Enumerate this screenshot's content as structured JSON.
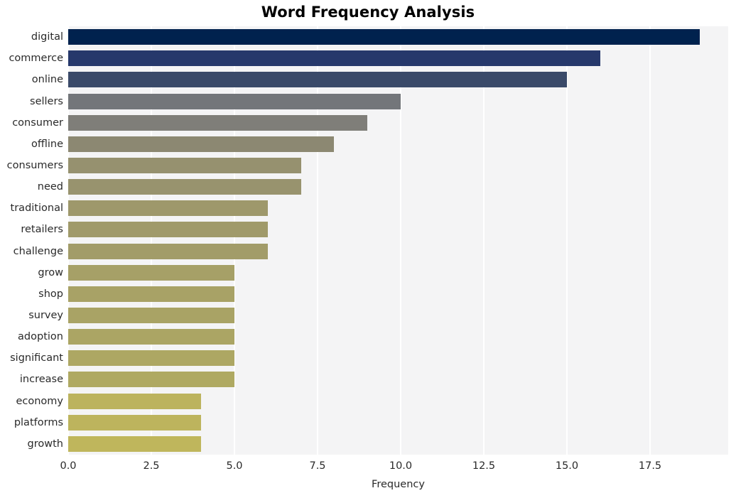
{
  "chart_data": {
    "type": "bar",
    "orientation": "horizontal",
    "title": "Word Frequency Analysis",
    "xlabel": "Frequency",
    "ylabel": "",
    "xlim": [
      0,
      19.85
    ],
    "xticks": [
      "0.0",
      "2.5",
      "5.0",
      "7.5",
      "10.0",
      "12.5",
      "15.0",
      "17.5"
    ],
    "xtick_values": [
      0,
      2.5,
      5,
      7.5,
      10,
      12.5,
      15,
      17.5
    ],
    "grid": "vertical-only",
    "legend": "none",
    "categories": [
      "digital",
      "commerce",
      "online",
      "sellers",
      "consumer",
      "offline",
      "consumers",
      "need",
      "traditional",
      "retailers",
      "challenge",
      "grow",
      "shop",
      "survey",
      "adoption",
      "significant",
      "increase",
      "economy",
      "platforms",
      "growth"
    ],
    "values": [
      19,
      16,
      15,
      10,
      9,
      8,
      7,
      7,
      6,
      6,
      6,
      5,
      5,
      5,
      5,
      5,
      5,
      4,
      4,
      4
    ],
    "bar_colors": [
      "#00224e",
      "#26386b",
      "#3a4a69",
      "#73767a",
      "#7f7e79",
      "#8c8872",
      "#96916f",
      "#98936e",
      "#9e986b",
      "#a09a6a",
      "#a29c69",
      "#a6a067",
      "#a8a266",
      "#a9a365",
      "#aba564",
      "#ada763",
      "#afa962",
      "#bcb35e",
      "#bdb45d",
      "#bfb65c"
    ],
    "plot_background": "#f4f4f5",
    "grid_color": "#ffffff",
    "figure_background": "#ffffff",
    "text_color": "#2a2a2a",
    "title_color": "#000000"
  }
}
